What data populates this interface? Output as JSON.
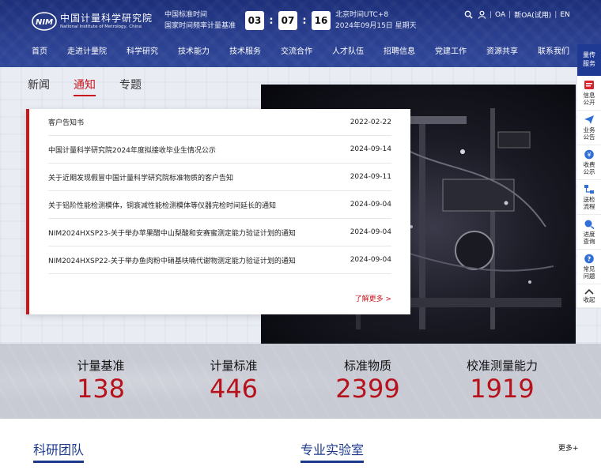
{
  "header": {
    "logo": {
      "cn": "中国计量科学研究院",
      "en": "National Institute of Metrology, China"
    },
    "time_label": {
      "line1": "中国标准时间",
      "line2": "国家时间频率计量基准"
    },
    "clock": {
      "hour": "03",
      "minute": "07",
      "second": "16",
      "sep": ":"
    },
    "beijing": {
      "line1": "北京时间UTC+8",
      "line2": "2024年09月15日 星期天"
    },
    "links": {
      "oa": "OA",
      "new_oa": "新OA(试用)",
      "en": "EN",
      "sep": "|"
    }
  },
  "nav": {
    "items": [
      "首页",
      "走进计量院",
      "科学研究",
      "技术能力",
      "技术服务",
      "交流合作",
      "人才队伍",
      "招聘信息",
      "党建工作",
      "资源共享",
      "联系我们"
    ]
  },
  "news": {
    "tabs": [
      "新闻",
      "通知",
      "专题"
    ],
    "active_tab": "通知",
    "items": [
      {
        "title": "客户告知书",
        "date": "2022-02-22"
      },
      {
        "title": "中国计量科学研究院2024年度拟接收毕业生情况公示",
        "date": "2024-09-14"
      },
      {
        "title": "关于近期发现假冒中国计量科学研究院标准物质的客户告知",
        "date": "2024-09-11"
      },
      {
        "title": "关于铝阶性能检测模体，铜衰减性能检测模体等仪器完检时间延长的通知",
        "date": "2024-09-04"
      },
      {
        "title": "NIM2024HXSP23-关于举办苹果醋中山梨酸和安赛蜜测定能力验证计划的通知",
        "date": "2024-09-04"
      },
      {
        "title": "NIM2024HXSP22-关于举办鱼肉粉中硝基呋喃代谢物测定能力验证计划的通知",
        "date": "2024-09-04"
      }
    ],
    "more": "了解更多 >"
  },
  "float_bar": {
    "top": {
      "line1": "量传",
      "line2": "服务"
    },
    "items": [
      {
        "line1": "信息",
        "line2": "公开",
        "icon": "info-public-icon"
      },
      {
        "line1": "业务",
        "line2": "公告",
        "icon": "paper-plane-icon"
      },
      {
        "line1": "收费",
        "line2": "公示",
        "icon": "yuan-coin-icon"
      },
      {
        "line1": "送检",
        "line2": "流程",
        "icon": "flow-icon"
      },
      {
        "line1": "进度",
        "line2": "查询",
        "icon": "progress-search-icon"
      },
      {
        "line1": "常见",
        "line2": "问题",
        "icon": "question-icon"
      },
      {
        "line1": "收起",
        "line2": "",
        "icon": "collapse-icon"
      }
    ],
    "accent": "#1f3a93"
  },
  "stats": [
    {
      "label": "计量基准",
      "value": "138"
    },
    {
      "label": "计量标准",
      "value": "446"
    },
    {
      "label": "标准物质",
      "value": "2399"
    },
    {
      "label": "校准测量能力",
      "value": "1919"
    }
  ],
  "bottom": {
    "team_title": "科研团队",
    "lab_title": "专业实验室",
    "more": "更多+"
  },
  "colors": {
    "accent_red": "#c8161d",
    "header_blue": "#2a3f8f",
    "stat_red": "#b7121b",
    "title_blue": "#1c3a8d"
  }
}
